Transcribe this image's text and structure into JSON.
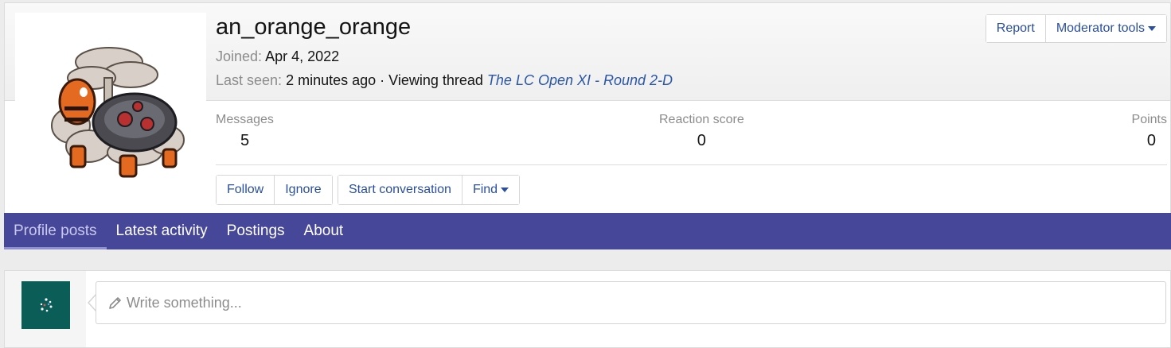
{
  "profile": {
    "username": "an_orange_orange",
    "joined_label": "Joined:",
    "joined_value": "Apr 4, 2022",
    "last_seen_label": "Last seen:",
    "last_seen_value": "2 minutes ago · Viewing thread",
    "last_seen_thread": "The LC Open XI - Round 2-D",
    "avatar_icon": "torkoal-sprite-icon"
  },
  "top_actions": {
    "report_label": "Report",
    "moderator_tools_label": "Moderator tools"
  },
  "stats": {
    "messages_label": "Messages",
    "messages_value": "5",
    "reaction_label": "Reaction score",
    "reaction_value": "0",
    "points_label": "Points",
    "points_value": "0"
  },
  "profile_actions": {
    "follow_label": "Follow",
    "ignore_label": "Ignore",
    "start_conversation_label": "Start conversation",
    "find_label": "Find"
  },
  "tabs": [
    {
      "label": "Profile posts",
      "active": true
    },
    {
      "label": "Latest activity",
      "active": false
    },
    {
      "label": "Postings",
      "active": false
    },
    {
      "label": "About",
      "active": false
    }
  ],
  "post_box": {
    "placeholder": "Write something...",
    "icon": "pencil-icon"
  },
  "colors": {
    "nav_bar": "#464799",
    "link": "#2a56a6",
    "mini_avatar": "#0a5e57"
  }
}
